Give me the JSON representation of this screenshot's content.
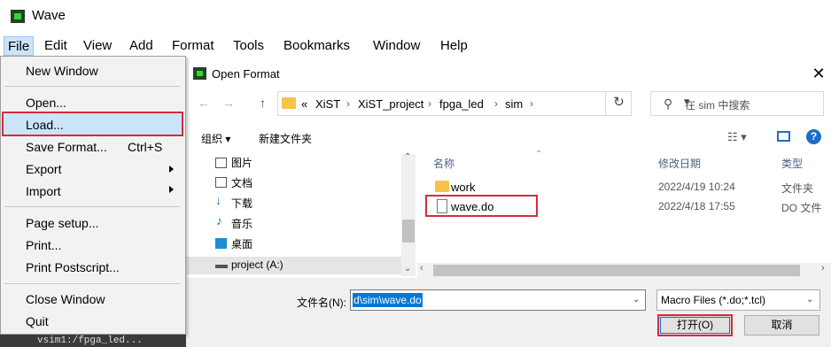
{
  "window": {
    "title": "Wave"
  },
  "menubar": [
    "File",
    "Edit",
    "View",
    "Add",
    "Format",
    "Tools",
    "Bookmarks",
    "Window",
    "Help"
  ],
  "file_menu": {
    "new_window": "New Window",
    "open": "Open...",
    "load": "Load...",
    "save_format": "Save Format...",
    "save_format_shortcut": "Ctrl+S",
    "export": "Export",
    "import": "Import",
    "page_setup": "Page setup...",
    "print": "Print...",
    "print_postscript": "Print Postscript...",
    "close_window": "Close Window",
    "quit": "Quit"
  },
  "bottom_strip": {
    "text": "vsim1:/fpga_led..."
  },
  "dialog": {
    "title": "Open Format",
    "close": "✕",
    "back": "←",
    "forward": "→",
    "up": "↑",
    "breadcrumb": [
      "«",
      "XiST",
      "XiST_project",
      "fpga_led",
      "sim"
    ],
    "search_placeholder": "在 sim 中搜索",
    "organize": "组织 ▾",
    "new_folder": "新建文件夹",
    "help": "?",
    "nav_items": [
      "图片",
      "文档",
      "下载",
      "音乐",
      "桌面",
      "project (A:)"
    ],
    "columns": {
      "name": "名称",
      "modified": "修改日期",
      "type": "类型"
    },
    "files": [
      {
        "name": "work",
        "date": "2022/4/19 10:24",
        "type": "文件夹"
      },
      {
        "name": "wave.do",
        "date": "2022/4/18 17:55",
        "type": "DO 文件"
      }
    ],
    "filename_label": "文件名(N):",
    "filename_value": "d\\sim\\wave.do",
    "filetype_value": "Macro Files (*.do;*.tcl)",
    "open_button": "打开(O)",
    "cancel_button": "取消"
  },
  "colors": {
    "highlight_border": "#d42c3c",
    "selection_blue": "#0078d7",
    "menu_highlight": "#cce4f7"
  }
}
